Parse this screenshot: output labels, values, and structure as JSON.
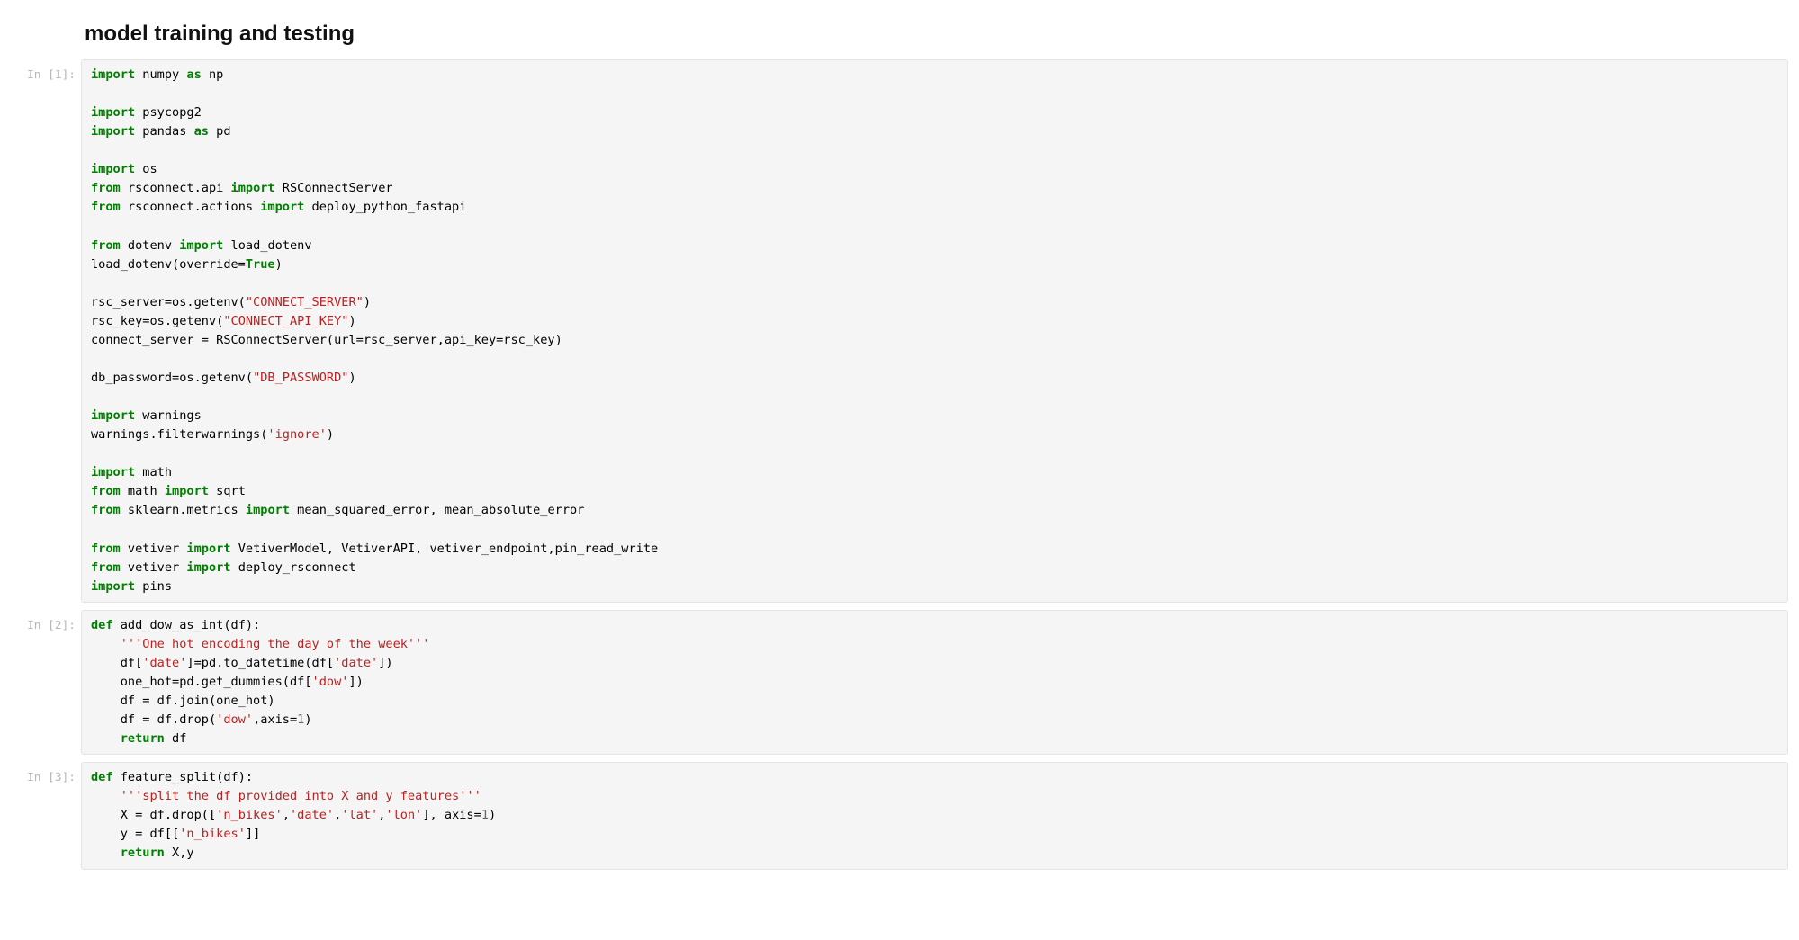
{
  "heading": "model training and testing",
  "prompts": {
    "p1": "In [1]:",
    "p2": "In [2]:",
    "p3": "In [3]:"
  },
  "cells": {
    "1": {
      "lines": [
        [
          [
            "kn",
            "import"
          ],
          [
            "",
            " numpy "
          ],
          [
            "kn",
            "as"
          ],
          [
            "",
            " np"
          ]
        ],
        [
          [
            "",
            ""
          ]
        ],
        [
          [
            "kn",
            "import"
          ],
          [
            "",
            " psycopg2"
          ]
        ],
        [
          [
            "kn",
            "import"
          ],
          [
            "",
            " pandas "
          ],
          [
            "kn",
            "as"
          ],
          [
            "",
            " pd"
          ]
        ],
        [
          [
            "",
            ""
          ]
        ],
        [
          [
            "kn",
            "import"
          ],
          [
            "",
            " os"
          ]
        ],
        [
          [
            "kn",
            "from"
          ],
          [
            "",
            " rsconnect.api "
          ],
          [
            "kn",
            "import"
          ],
          [
            "",
            " RSConnectServer"
          ]
        ],
        [
          [
            "kn",
            "from"
          ],
          [
            "",
            " rsconnect.actions "
          ],
          [
            "kn",
            "import"
          ],
          [
            "",
            " deploy_python_fastapi"
          ]
        ],
        [
          [
            "",
            ""
          ]
        ],
        [
          [
            "kn",
            "from"
          ],
          [
            "",
            " dotenv "
          ],
          [
            "kn",
            "import"
          ],
          [
            "",
            " load_dotenv"
          ]
        ],
        [
          [
            "",
            "load_dotenv(override="
          ],
          [
            "bp",
            "True"
          ],
          [
            "",
            ")"
          ]
        ],
        [
          [
            "",
            ""
          ]
        ],
        [
          [
            "",
            "rsc_server=os.getenv("
          ],
          [
            "s",
            "\"CONNECT_SERVER\""
          ],
          [
            "",
            ")"
          ]
        ],
        [
          [
            "",
            "rsc_key=os.getenv("
          ],
          [
            "s",
            "\"CONNECT_API_KEY\""
          ],
          [
            "",
            ")"
          ]
        ],
        [
          [
            "",
            "connect_server = RSConnectServer(url=rsc_server,api_key=rsc_key)"
          ]
        ],
        [
          [
            "",
            ""
          ]
        ],
        [
          [
            "",
            "db_password=os.getenv("
          ],
          [
            "s",
            "\"DB_PASSWORD\""
          ],
          [
            "",
            ")"
          ]
        ],
        [
          [
            "",
            ""
          ]
        ],
        [
          [
            "kn",
            "import"
          ],
          [
            "",
            " warnings"
          ]
        ],
        [
          [
            "",
            "warnings.filterwarnings("
          ],
          [
            "s",
            "'ignore'"
          ],
          [
            "",
            ")"
          ]
        ],
        [
          [
            "",
            ""
          ]
        ],
        [
          [
            "kn",
            "import"
          ],
          [
            "",
            " math"
          ]
        ],
        [
          [
            "kn",
            "from"
          ],
          [
            "",
            " math "
          ],
          [
            "kn",
            "import"
          ],
          [
            "",
            " sqrt"
          ]
        ],
        [
          [
            "kn",
            "from"
          ],
          [
            "",
            " sklearn.metrics "
          ],
          [
            "kn",
            "import"
          ],
          [
            "",
            " mean_squared_error, mean_absolute_error"
          ]
        ],
        [
          [
            "",
            ""
          ]
        ],
        [
          [
            "kn",
            "from"
          ],
          [
            "",
            " vetiver "
          ],
          [
            "kn",
            "import"
          ],
          [
            "",
            " VetiverModel, VetiverAPI, vetiver_endpoint,pin_read_write"
          ]
        ],
        [
          [
            "kn",
            "from"
          ],
          [
            "",
            " vetiver "
          ],
          [
            "kn",
            "import"
          ],
          [
            "",
            " deploy_rsconnect"
          ]
        ],
        [
          [
            "kn",
            "import"
          ],
          [
            "",
            " pins"
          ]
        ]
      ]
    },
    "2": {
      "lines": [
        [
          [
            "k",
            "def"
          ],
          [
            "",
            " add_dow_as_int(df):"
          ]
        ],
        [
          [
            "",
            "    "
          ],
          [
            "s",
            "'''One hot encoding the day of the week'''"
          ]
        ],
        [
          [
            "",
            "    df["
          ],
          [
            "s",
            "'date'"
          ],
          [
            "",
            "]=pd.to_datetime(df["
          ],
          [
            "s",
            "'date'"
          ],
          [
            "",
            "])"
          ]
        ],
        [
          [
            "",
            "    one_hot=pd.get_dummies(df["
          ],
          [
            "s",
            "'dow'"
          ],
          [
            "",
            "])"
          ]
        ],
        [
          [
            "",
            "    df = df.join(one_hot)"
          ]
        ],
        [
          [
            "",
            "    df = df.drop("
          ],
          [
            "s",
            "'dow'"
          ],
          [
            "",
            ",axis="
          ],
          [
            "mi",
            "1"
          ],
          [
            "",
            ")"
          ]
        ],
        [
          [
            "",
            "    "
          ],
          [
            "k",
            "return"
          ],
          [
            "",
            " df"
          ]
        ]
      ]
    },
    "3": {
      "lines": [
        [
          [
            "k",
            "def"
          ],
          [
            "",
            " feature_split(df):"
          ]
        ],
        [
          [
            "",
            "    "
          ],
          [
            "s",
            "'''split the df provided into X and y features'''"
          ]
        ],
        [
          [
            "",
            "    X = df.drop(["
          ],
          [
            "s",
            "'n_bikes'"
          ],
          [
            "",
            ","
          ],
          [
            "s",
            "'date'"
          ],
          [
            "",
            ","
          ],
          [
            "s",
            "'lat'"
          ],
          [
            "",
            ","
          ],
          [
            "s",
            "'lon'"
          ],
          [
            "",
            "], axis="
          ],
          [
            "mi",
            "1"
          ],
          [
            "",
            ")"
          ]
        ],
        [
          [
            "",
            "    y = df[["
          ],
          [
            "s",
            "'n_bikes'"
          ],
          [
            "",
            "]]"
          ]
        ],
        [
          [
            "",
            "    "
          ],
          [
            "k",
            "return"
          ],
          [
            "",
            " X,y"
          ]
        ]
      ]
    }
  }
}
